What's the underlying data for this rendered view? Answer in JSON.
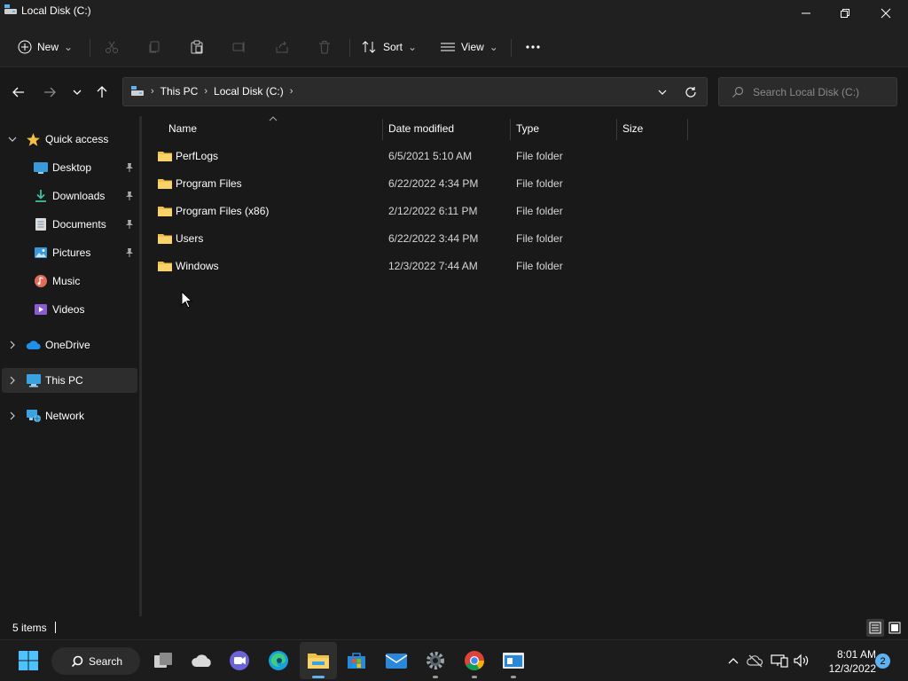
{
  "window": {
    "title": "Local Disk (C:)"
  },
  "toolbar": {
    "new_label": "New",
    "sort_label": "Sort",
    "view_label": "View"
  },
  "address": {
    "crumbs": [
      "This PC",
      "Local Disk (C:)"
    ],
    "search_placeholder": "Search Local Disk (C:)"
  },
  "sidebar": {
    "items": [
      {
        "label": "Quick access",
        "icon": "star-icon"
      },
      {
        "label": "Desktop",
        "icon": "desktop-icon",
        "pinned": true
      },
      {
        "label": "Downloads",
        "icon": "download-icon",
        "pinned": true
      },
      {
        "label": "Documents",
        "icon": "document-icon",
        "pinned": true
      },
      {
        "label": "Pictures",
        "icon": "picture-icon",
        "pinned": true
      },
      {
        "label": "Music",
        "icon": "music-icon"
      },
      {
        "label": "Videos",
        "icon": "video-icon"
      },
      {
        "label": "OneDrive",
        "icon": "cloud-icon"
      },
      {
        "label": "This PC",
        "icon": "computer-icon",
        "selected": true
      },
      {
        "label": "Network",
        "icon": "network-icon"
      }
    ]
  },
  "files": {
    "columns": [
      "Name",
      "Date modified",
      "Type",
      "Size"
    ],
    "rows": [
      {
        "name": "PerfLogs",
        "date": "6/5/2021 5:10 AM",
        "type": "File folder"
      },
      {
        "name": "Program Files",
        "date": "6/22/2022 4:34 PM",
        "type": "File folder"
      },
      {
        "name": "Program Files (x86)",
        "date": "2/12/2022 6:11 PM",
        "type": "File folder"
      },
      {
        "name": "Users",
        "date": "6/22/2022 3:44 PM",
        "type": "File folder"
      },
      {
        "name": "Windows",
        "date": "12/3/2022 7:44 AM",
        "type": "File folder"
      }
    ]
  },
  "status": {
    "count": "5 items"
  },
  "taskbar": {
    "search_label": "Search",
    "time": "8:01 AM",
    "date": "12/3/2022",
    "notifications": "2"
  },
  "colors": {
    "accent": "#5fb2f2",
    "folder": "#f3c046",
    "background": "#191919"
  }
}
